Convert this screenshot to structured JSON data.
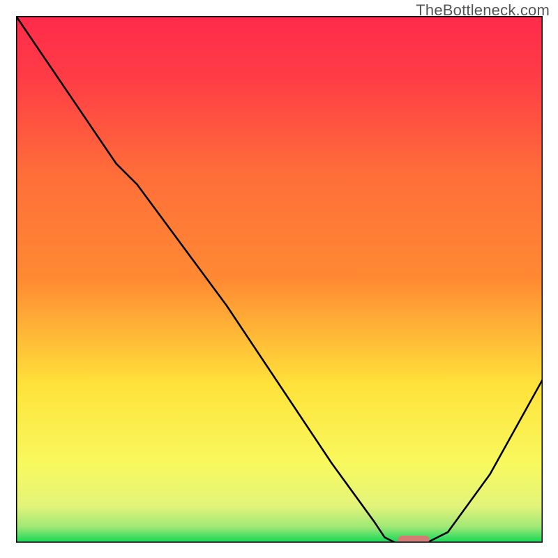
{
  "watermark": "TheBottleneck.com",
  "chart_data": {
    "type": "line",
    "title": "",
    "xlabel": "",
    "ylabel": "",
    "xlim": [
      0,
      100
    ],
    "ylim": [
      0,
      100
    ],
    "gradient_colors": {
      "top": "#ff2a4b",
      "mid1": "#ff8a33",
      "mid2": "#ffe23a",
      "mid3": "#f8f95e",
      "bottom": "#11d857"
    },
    "series": [
      {
        "name": "curve",
        "points": [
          {
            "x": 0.0,
            "y": 100.0
          },
          {
            "x": 19.0,
            "y": 72.0
          },
          {
            "x": 23.0,
            "y": 68.0
          },
          {
            "x": 40.0,
            "y": 45.0
          },
          {
            "x": 60.0,
            "y": 15.0
          },
          {
            "x": 68.0,
            "y": 4.0
          },
          {
            "x": 70.0,
            "y": 1.0
          },
          {
            "x": 72.0,
            "y": 0.0
          },
          {
            "x": 78.0,
            "y": 0.0
          },
          {
            "x": 82.0,
            "y": 2.0
          },
          {
            "x": 90.0,
            "y": 13.0
          },
          {
            "x": 100.0,
            "y": 31.0
          }
        ]
      },
      {
        "name": "marker",
        "shape": "rounded-bar",
        "color": "#d67a76",
        "points": [
          {
            "x": 72.5,
            "y": 0.0
          },
          {
            "x": 78.5,
            "y": 0.0
          }
        ]
      }
    ]
  }
}
